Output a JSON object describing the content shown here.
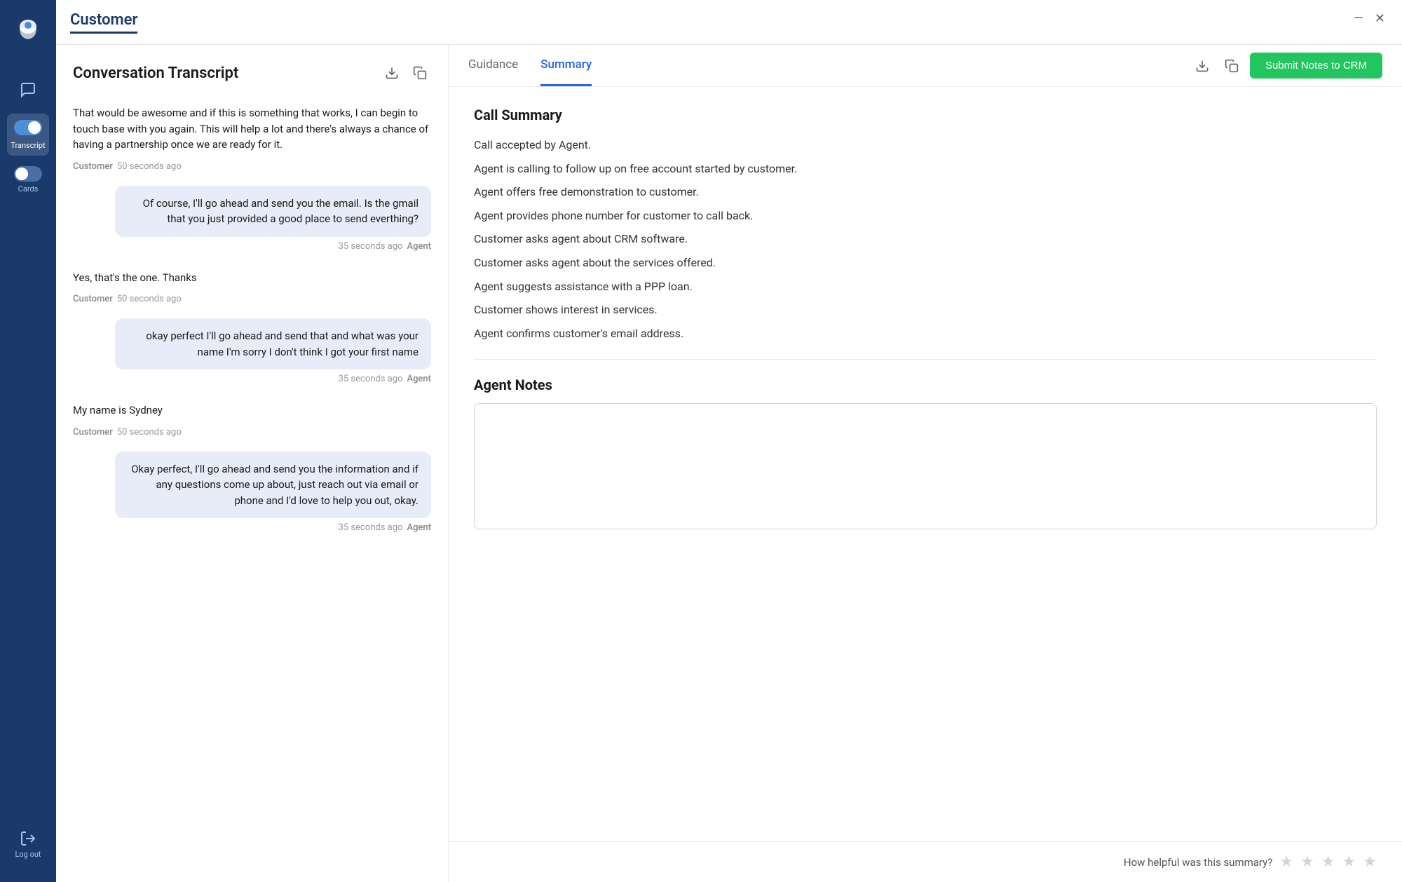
{
  "app": {
    "title": "Customer",
    "logo_alt": "Five9 logo"
  },
  "sidebar": {
    "items": [
      {
        "id": "chat",
        "label": "",
        "icon": "chat-icon",
        "active": false
      },
      {
        "id": "transcript",
        "label": "Transcript",
        "active": true
      },
      {
        "id": "cards",
        "label": "Cards",
        "active": false
      },
      {
        "id": "logout",
        "label": "Log out",
        "active": false
      }
    ]
  },
  "transcript": {
    "title": "Conversation Transcript",
    "messages": [
      {
        "id": "msg1",
        "type": "customer",
        "text": "That would be awesome and if this is something that works, I can begin to touch base with you again. This will help a lot and there's always a chance of having a partnership once we are ready for it.",
        "sender": "Customer",
        "time": "50 seconds ago"
      },
      {
        "id": "msg2",
        "type": "agent",
        "text": "Of course, I'll go ahead and send you the email. Is the gmail that you just provided a good place to send everthing?",
        "sender": "Agent",
        "time": "35 seconds ago"
      },
      {
        "id": "msg3",
        "type": "customer",
        "text": "Yes, that's the one. Thanks",
        "sender": "Customer",
        "time": "50 seconds ago"
      },
      {
        "id": "msg4",
        "type": "agent",
        "text": "okay perfect I'll go ahead and send that and what was your name I'm sorry I don't think I got your first name",
        "sender": "Agent",
        "time": "35 seconds ago"
      },
      {
        "id": "msg5",
        "type": "customer",
        "text": "My name is Sydney",
        "sender": "Customer",
        "time": "50 seconds ago"
      },
      {
        "id": "msg6",
        "type": "agent",
        "text": "Okay perfect, I'll go ahead and send you the information and if any questions come up about, just reach out via email or phone and I'd love to help you out, okay.",
        "sender": "Agent",
        "time": "35 seconds ago"
      }
    ]
  },
  "right_panel": {
    "tabs": [
      {
        "id": "guidance",
        "label": "Guidance",
        "active": false
      },
      {
        "id": "summary",
        "label": "Summary",
        "active": true
      }
    ],
    "submit_button_label": "Submit Notes to CRM",
    "call_summary": {
      "title": "Call Summary",
      "items": [
        "Call accepted by Agent.",
        "Agent is calling to follow up on free account started by customer.",
        "Agent offers free demonstration to customer.",
        "Agent provides phone number for customer to call back.",
        "Customer asks agent about CRM software.",
        "Customer asks agent about the services offered.",
        "Agent suggests assistance with a PPP loan.",
        "Customer shows interest in services.",
        "Agent confirms customer's email address."
      ]
    },
    "agent_notes": {
      "title": "Agent Notes",
      "placeholder": ""
    },
    "rating": {
      "label": "How helpful was this summary?",
      "stars": [
        1,
        2,
        3,
        4,
        5
      ]
    }
  },
  "window_controls": {
    "minimize": "—",
    "close": "✕"
  }
}
